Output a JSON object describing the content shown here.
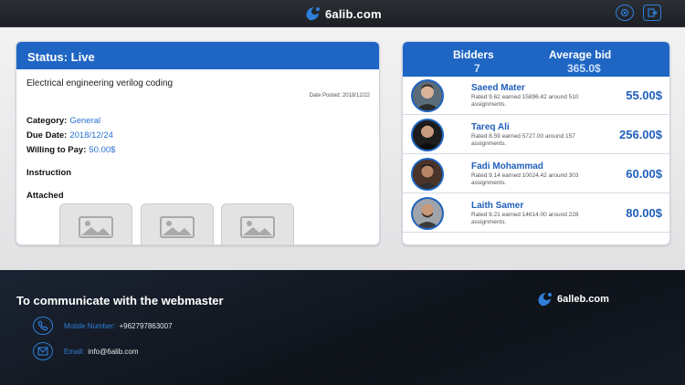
{
  "header": {
    "brand": "6alib.com"
  },
  "status": {
    "title": "Status: Live",
    "job_title": "Electrical engineering verilog coding",
    "date_posted": "Date Posted: 2018/12/22",
    "category_label": "Category:",
    "category_value": "General",
    "due_label": "Due Date:",
    "due_value": "2018/12/24",
    "pay_label": "Willing to Pay:",
    "pay_value": "50.00$",
    "instruction_label": "Instruction",
    "attached_label": "Attached"
  },
  "bids": {
    "bidders_label": "Bidders",
    "bidders_count": "7",
    "average_label": "Average bid",
    "average_value": "365.0$",
    "list": [
      {
        "name": "Saeed Mater",
        "desc": "Rated 9.62 earned 15896.42 around 510 assignments.",
        "amount": "55.00$"
      },
      {
        "name": "Tareq Ali",
        "desc": "Rated 8.59 earned 5727.00 around 157 assignments.",
        "amount": "256.00$"
      },
      {
        "name": "Fadi Mohammad",
        "desc": "Rated 9.14 earned 10024.42 around 303 assignments.",
        "amount": "60.00$"
      },
      {
        "name": "Laith Samer",
        "desc": "Rated 9.21 earned 14614.00 around 228 assignments.",
        "amount": "80.00$"
      }
    ]
  },
  "footer": {
    "title": "To communicate with the webmaster",
    "brand": "6alleb.com",
    "mobile_label": "Mobile Number:",
    "mobile_value": "+962797863007",
    "email_label": "Email:",
    "email_value": "info@6alib.com"
  },
  "colors": {
    "primary": "#1f66c4",
    "accent": "#2f7fd9",
    "footer_bg": "#141a24"
  },
  "icons": [
    "settings-icon",
    "logout-icon",
    "image-placeholder-icon",
    "phone-icon",
    "email-icon"
  ]
}
